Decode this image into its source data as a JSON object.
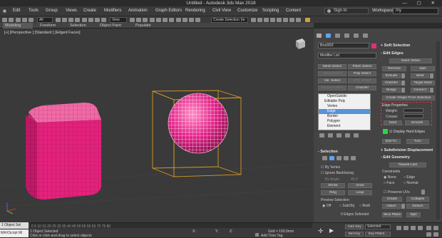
{
  "window": {
    "title": "Untitled - Autodesk 3ds Max 2018"
  },
  "menu": [
    "Edit",
    "Tools",
    "Group",
    "Views",
    "Create",
    "Modifiers",
    "Animation",
    "Graph Editors",
    "Rendering",
    "Civil View",
    "Customize",
    "Scripting",
    "Content"
  ],
  "account": {
    "signin": "Sign In",
    "workspace_label": "Workspaces:",
    "workspace_value": "my"
  },
  "toolbar": {
    "filter": "All",
    "view": "View",
    "selection_set": "Create Selection Se"
  },
  "ribbon_tabs": [
    "Modeling",
    "Freeform",
    "Selection",
    "Object Paint",
    "Populate"
  ],
  "viewport": {
    "label": "[+] [Perspective ] [Standard ] [Edged Faces]"
  },
  "command_panel": {
    "object_name": "Box002",
    "object_color": "#e0307a",
    "modifier_list": "Modifier List",
    "quick_buttons": {
      "mesh_select": "Mesh Select",
      "patch_select": "Patch Select",
      "splineselect": "SplineSelect",
      "poly_select": "Poly Select",
      "vol_select": "Vol. Select",
      "fkd_select": "FFD Select",
      "surface_select": "Surface Select",
      "chamfer": "Chamfer"
    },
    "stack": [
      {
        "label": "OpenSubdiv"
      },
      {
        "label": "Editable Poly"
      },
      {
        "label": "Vertex"
      },
      {
        "label": "Edge"
      },
      {
        "label": "Border"
      },
      {
        "label": "Polygon"
      },
      {
        "label": "Element"
      }
    ],
    "selection": {
      "title": "Selection",
      "by_vertex": "By Vertex",
      "ignore_backfacing": "Ignore Backfacing",
      "by_angle": "By Angle:",
      "angle_value": "45.0",
      "shrink": "Shrink",
      "grow": "Grow",
      "ring": "Ring",
      "loop": "Loop",
      "preview_selection": "Preview Selection",
      "off": "Off",
      "subobj": "SubObj",
      "multi": "Multi",
      "status": "0 Edges Selected"
    }
  },
  "right_panel": {
    "soft_selection": "Soft Selection",
    "edit_edges": "Edit Edges",
    "insert_vertex": "Insert Vertex",
    "remove": "Remove",
    "split": "Split",
    "extrude": "Extrude",
    "weld": "Weld",
    "chamfer": "Chamfer",
    "target_weld": "Target Weld",
    "bridge": "Bridge",
    "connect": "Connect",
    "create_shape": "Create Shape From Selection",
    "edge_properties": "Edge Properties",
    "weight": "Weight:",
    "crease": "Crease:",
    "hard": "Hard",
    "smooth": "Smooth",
    "display_hard_edges": "Display Hard Edges",
    "edit_tri": "Edit Tri.",
    "turn": "Turn",
    "subdivision_displacement": "Subdivision Displacement",
    "edit_geometry": "Edit Geometry",
    "repeat_last": "Repeat Last",
    "constraints": "Constraints",
    "none": "None",
    "edge": "Edge",
    "face": "Face",
    "normal": "Normal",
    "preserve_uvs": "Preserve UVs",
    "create": "Create",
    "collapse": "Collapse",
    "attach": "Attach",
    "detach": "Detach",
    "slice_plane": "Slice Plane",
    "split2": "Split"
  },
  "status": {
    "objects_selected": "1 Object Selected",
    "hint": "Click or click-and-drag to select objects",
    "grid": "Grid = 100.0mm",
    "add_time_tag": "Add Time Tag",
    "auto_key": "Auto Key",
    "selected": "Selected",
    "set_key": "Set Key",
    "key_filters": "Key Filters..."
  },
  "left_bottom": {
    "selection": "1 Object Sel",
    "maxscript": "MAXScript Mi"
  }
}
